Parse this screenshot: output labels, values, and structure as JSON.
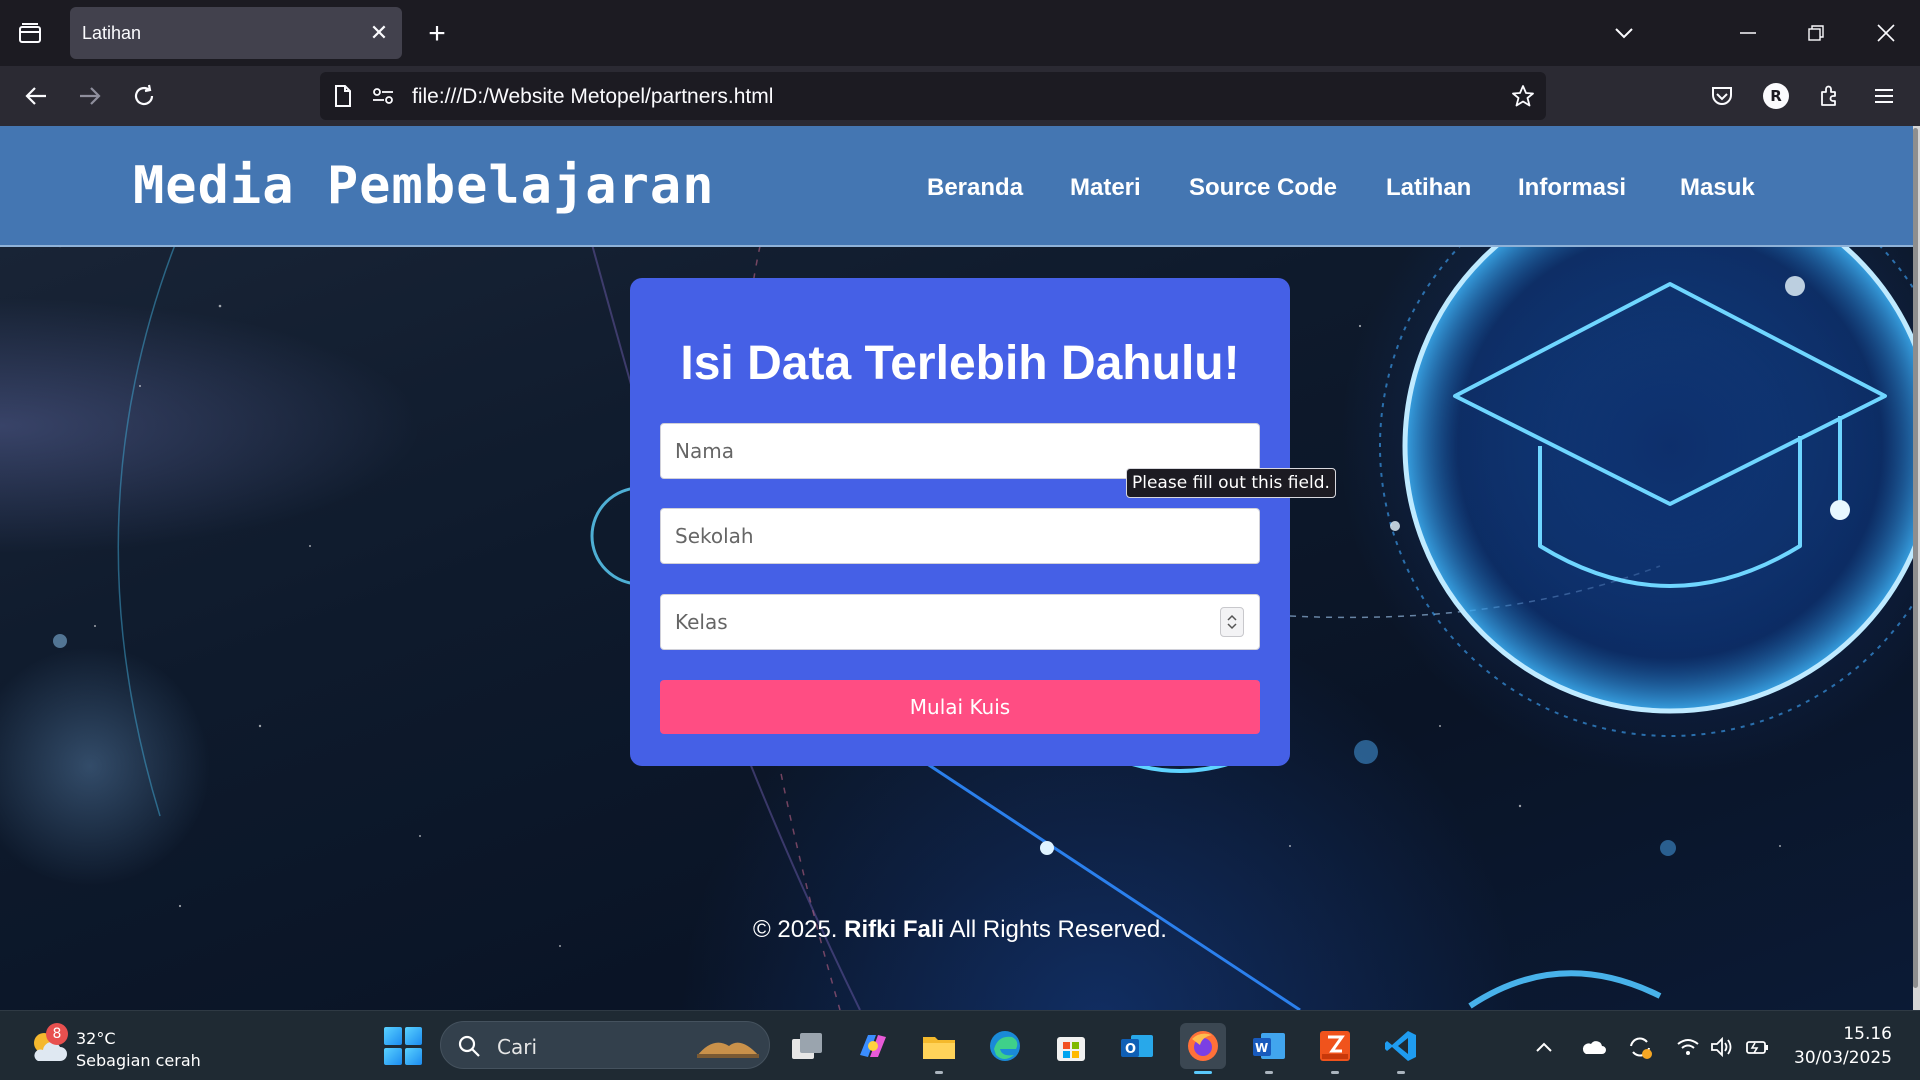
{
  "browser": {
    "tab_title": "Latihan",
    "tab_close_glyph": "✕",
    "new_tab_glyph": "+",
    "url": "file:///D:/Website Metopel/partners.html",
    "profile_initial": "R",
    "icons": [
      "tab-list-icon",
      "chevron-down-icon",
      "minimize-icon",
      "restore-icon",
      "close-icon",
      "back-arrow-icon",
      "forward-arrow-icon",
      "reload-icon",
      "page-icon",
      "permissions-icon",
      "bookmark-star-icon",
      "pocket-icon",
      "extensions-icon",
      "menu-icon"
    ]
  },
  "site": {
    "logo": "Media Pembelajaran",
    "nav": [
      "Beranda",
      "Materi",
      "Source Code",
      "Latihan",
      "Informasi",
      "Masuk"
    ],
    "header_color": "#4476b2"
  },
  "form": {
    "title": "Isi Data Terlebih Dahulu!",
    "name_placeholder": "Nama",
    "school_placeholder": "Sekolah",
    "class_placeholder": "Kelas",
    "submit_label": "Mulai Kuis",
    "card_color": "#4560e6",
    "button_color": "#ff4d83"
  },
  "tooltip": "Please fill out this field.",
  "footer": {
    "prefix": "© 2025.",
    "author": "Rifki Fali",
    "suffix": "All Rights Reserved."
  },
  "taskbar": {
    "weather_badge": "8",
    "weather_temp": "32°C",
    "weather_desc": "Sebagian cerah",
    "search_placeholder": "Cari",
    "apps": [
      "task-view-icon",
      "copilot-icon",
      "file-explorer-icon",
      "edge-icon",
      "microsoft-store-icon",
      "outlook-icon",
      "firefox-icon",
      "word-icon",
      "pdf-reader-icon",
      "vscode-icon"
    ],
    "time": "15.16",
    "date": "30/03/2025"
  }
}
